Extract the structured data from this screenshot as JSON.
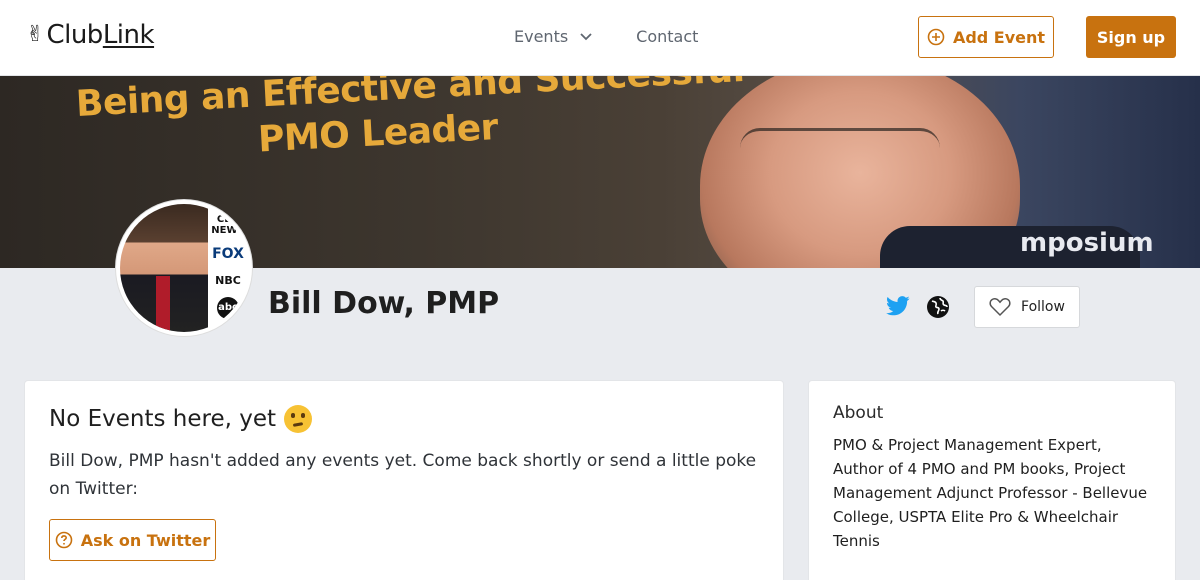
{
  "header": {
    "logo_text_club": "Club",
    "logo_text_link": "Link",
    "nav_events": "Events",
    "nav_contact": "Contact",
    "add_event_label": "Add Event",
    "signup_label": "Sign up"
  },
  "banner": {
    "line1": "Being an Effective and Successful",
    "line2": "PMO Leader",
    "sign": "mposium"
  },
  "profile": {
    "name": "Bill Dow, PMP",
    "follow_label": "Follow",
    "avatar_logos": [
      "CBS NEWS",
      "FOX",
      "NBC",
      "abc"
    ]
  },
  "events_card": {
    "title": "No Events here, yet",
    "message": "Bill Dow, PMP hasn't added any events yet. Come back shortly or send a little poke on Twitter:",
    "ask_label": "Ask on Twitter"
  },
  "about_card": {
    "title": "About",
    "text": "PMO & Project Management Expert, Author of 4 PMO and PM books, Project Management Adjunct Professor - Bellevue College, USPTA Elite Pro & Wheelchair Tennis"
  },
  "colors": {
    "accent": "#c8720f",
    "twitter": "#1da1f2",
    "background": "#e9ebef"
  }
}
